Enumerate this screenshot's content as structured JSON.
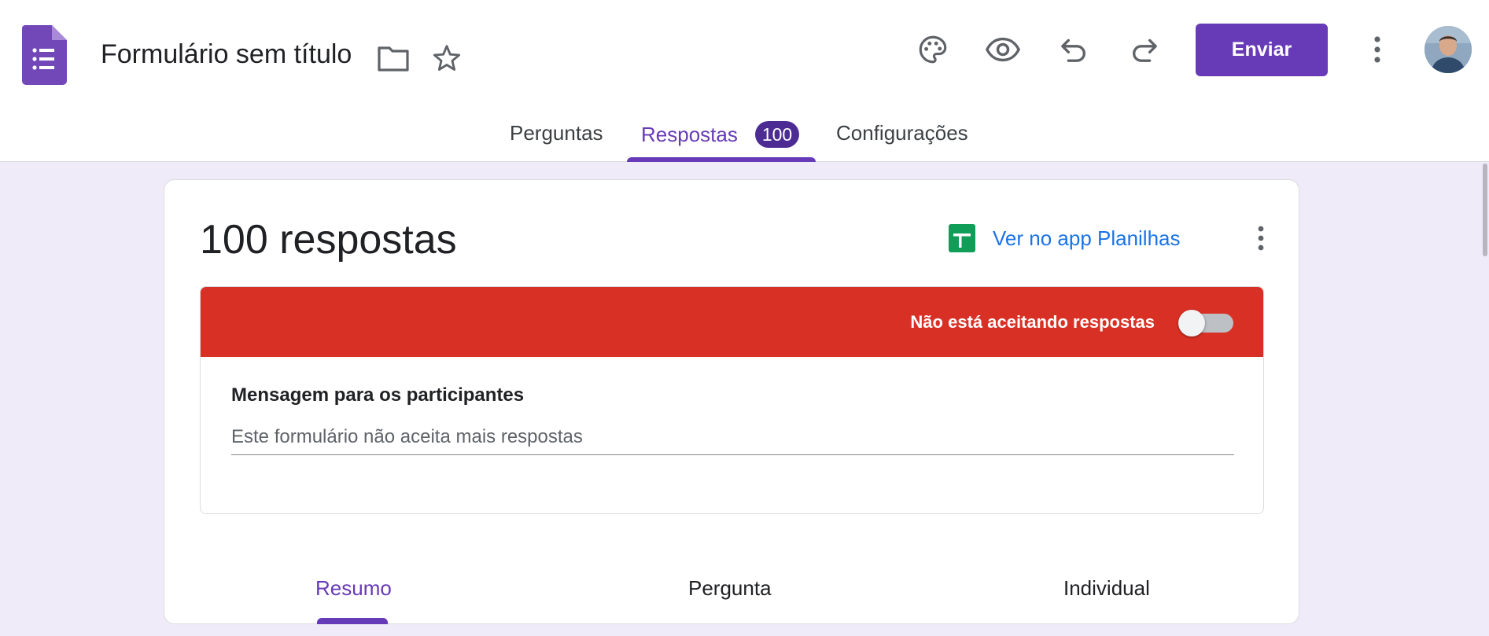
{
  "app": {
    "title": "Formulário sem título",
    "send_label": "Enviar",
    "brand_color": "#673ab7"
  },
  "icons": {
    "logo": "google-forms-icon",
    "folder": "folder-icon",
    "star": "star-icon",
    "palette": "palette-icon",
    "preview": "eye-icon",
    "undo": "undo-icon",
    "redo": "redo-icon",
    "more": "more-vert-icon",
    "sheets": "google-sheets-icon"
  },
  "tabs": [
    {
      "label": "Perguntas"
    },
    {
      "label": "Respostas",
      "badge": "100",
      "active": true
    },
    {
      "label": "Configurações"
    }
  ],
  "responses": {
    "count_label": "100 respostas",
    "sheets_link": "Ver no app Planilhas",
    "accepting_label": "Não está aceitando respostas",
    "accepting": false,
    "banner_color": "#d93025",
    "message_label": "Mensagem para os participantes",
    "message_placeholder": "Este formulário não aceita mais respostas",
    "message_value": ""
  },
  "sub_tabs": [
    {
      "label": "Resumo",
      "active": true
    },
    {
      "label": "Pergunta"
    },
    {
      "label": "Individual"
    }
  ]
}
